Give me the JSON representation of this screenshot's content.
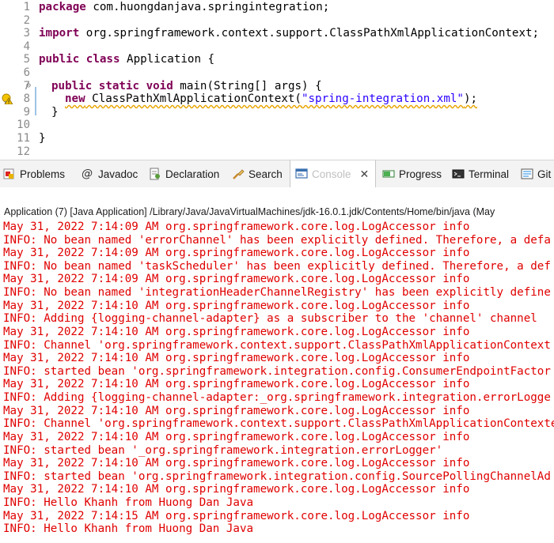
{
  "editor": {
    "lines": [
      {
        "num": "1",
        "kw1": "package",
        "text": " com.huongdanjava.springintegration;"
      },
      {
        "num": "2"
      },
      {
        "num": "3",
        "kw1": "import",
        "text": " org.springframework.context.support.ClassPathXmlApplicationContext;"
      },
      {
        "num": "4"
      },
      {
        "num": "5",
        "kw1": "public",
        "kw2": "class",
        "text": " Application {"
      },
      {
        "num": "6"
      },
      {
        "num": "7",
        "kw1": "public",
        "kw2": "static",
        "kw3": "void",
        "text": " main(String[] args) {"
      },
      {
        "num": "8",
        "kw1": "new",
        "text_a": " ClassPathXmlApplicationContext(",
        "str": "\"spring-integration.xml\"",
        "text_b": ");"
      },
      {
        "num": "9",
        "text": "}"
      },
      {
        "num": "10"
      },
      {
        "num": "11",
        "text": "}"
      },
      {
        "num": "12"
      }
    ]
  },
  "tabs": [
    {
      "label": "Problems",
      "icon": "problems-icon"
    },
    {
      "label": "Javadoc",
      "icon": "javadoc-icon",
      "glyph": "@"
    },
    {
      "label": "Declaration",
      "icon": "declaration-icon"
    },
    {
      "label": "Search",
      "icon": "search-icon"
    },
    {
      "label": "Console",
      "icon": "console-icon",
      "active": true
    },
    {
      "label": "Progress",
      "icon": "progress-icon"
    },
    {
      "label": "Terminal",
      "icon": "terminal-icon"
    },
    {
      "label": "Git",
      "icon": "git-icon"
    }
  ],
  "console": {
    "header": "Application (7) [Java Application] /Library/Java/JavaVirtualMachines/jdk-16.0.1.jdk/Contents/Home/bin/java  (May",
    "lines": [
      "May 31, 2022 7:14:09 AM org.springframework.core.log.LogAccessor info",
      "INFO: No bean named 'errorChannel' has been explicitly defined. Therefore, a defa",
      "May 31, 2022 7:14:09 AM org.springframework.core.log.LogAccessor info",
      "INFO: No bean named 'taskScheduler' has been explicitly defined. Therefore, a def",
      "May 31, 2022 7:14:09 AM org.springframework.core.log.LogAccessor info",
      "INFO: No bean named 'integrationHeaderChannelRegistry' has been explicitly define",
      "May 31, 2022 7:14:10 AM org.springframework.core.log.LogAccessor info",
      "INFO: Adding {logging-channel-adapter} as a subscriber to the 'channel' channel",
      "May 31, 2022 7:14:10 AM org.springframework.core.log.LogAccessor info",
      "INFO: Channel 'org.springframework.context.support.ClassPathXmlApplicationContext",
      "May 31, 2022 7:14:10 AM org.springframework.core.log.LogAccessor info",
      "INFO: started bean 'org.springframework.integration.config.ConsumerEndpointFactor",
      "May 31, 2022 7:14:10 AM org.springframework.core.log.LogAccessor info",
      "INFO: Adding {logging-channel-adapter:_org.springframework.integration.errorLogge",
      "May 31, 2022 7:14:10 AM org.springframework.core.log.LogAccessor info",
      "INFO: Channel 'org.springframework.context.support.ClassPathXmlApplicationContexte",
      "May 31, 2022 7:14:10 AM org.springframework.core.log.LogAccessor info",
      "INFO: started bean '_org.springframework.integration.errorLogger'",
      "May 31, 2022 7:14:10 AM org.springframework.core.log.LogAccessor info",
      "INFO: started bean 'org.springframework.integration.config.SourcePollingChannelAd",
      "May 31, 2022 7:14:10 AM org.springframework.core.log.LogAccessor info",
      "INFO: Hello Khanh from Huong Dan Java",
      "May 31, 2022 7:14:15 AM org.springframework.core.log.LogAccessor info",
      "INFO: Hello Khanh from Huong Dan Java"
    ]
  }
}
